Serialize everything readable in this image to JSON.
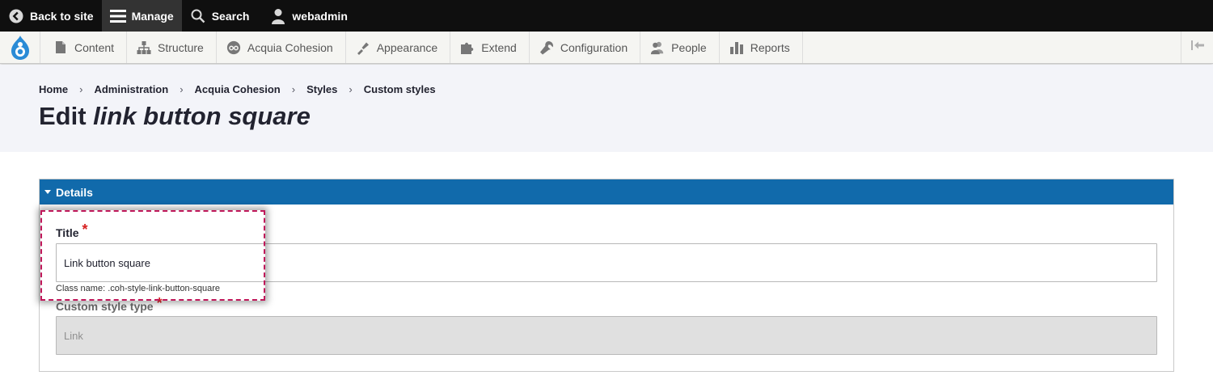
{
  "toolbar": {
    "back_to_site": "Back to site",
    "manage": "Manage",
    "search": "Search",
    "user": "webadmin"
  },
  "tray": {
    "items": [
      {
        "label": "Content",
        "icon": "file-icon"
      },
      {
        "label": "Structure",
        "icon": "sitemap-icon"
      },
      {
        "label": "Acquia Cohesion",
        "icon": "cohesion-icon"
      },
      {
        "label": "Appearance",
        "icon": "brush-icon"
      },
      {
        "label": "Extend",
        "icon": "puzzle-icon"
      },
      {
        "label": "Configuration",
        "icon": "wrench-icon"
      },
      {
        "label": "People",
        "icon": "people-icon"
      },
      {
        "label": "Reports",
        "icon": "bar-chart-icon"
      }
    ]
  },
  "breadcrumb": [
    "Home",
    "Administration",
    "Acquia Cohesion",
    "Styles",
    "Custom styles"
  ],
  "breadcrumb_separator": "›",
  "page": {
    "title_prefix": "Edit ",
    "title_entity": "link button square"
  },
  "details": {
    "summary": "Details",
    "title_field": {
      "label": "Title",
      "required_mark": "*",
      "value": "Link button square",
      "description": "Class name: .coh-style-link-button-square"
    },
    "type_field": {
      "label": "Custom style type",
      "required_mark": "*",
      "value": "Link"
    }
  },
  "colors": {
    "toolbar_bg": "#0f0f0f",
    "details_header": "#116aab",
    "required": "#d72222",
    "highlight": "#c0185a"
  }
}
